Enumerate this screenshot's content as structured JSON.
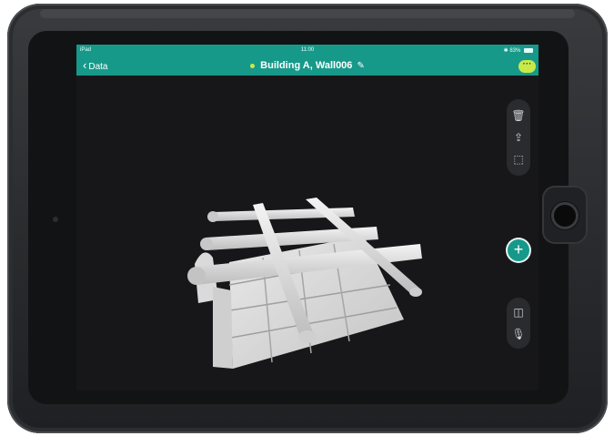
{
  "status_bar": {
    "device": "iPad",
    "time": "11:00",
    "battery": "83%"
  },
  "nav": {
    "back_label": "Data",
    "title": "Building A, Wall006",
    "more_label": "···"
  },
  "tools": {
    "top": [
      "trash-icon",
      "share-icon",
      "selection-rect-icon"
    ],
    "add": "plus-icon",
    "bottom": [
      "split-view-icon",
      "microphone-icon"
    ]
  },
  "colors": {
    "accent": "#17998a",
    "status_dot": "#c9e94a",
    "model": "#e8e8e8"
  }
}
